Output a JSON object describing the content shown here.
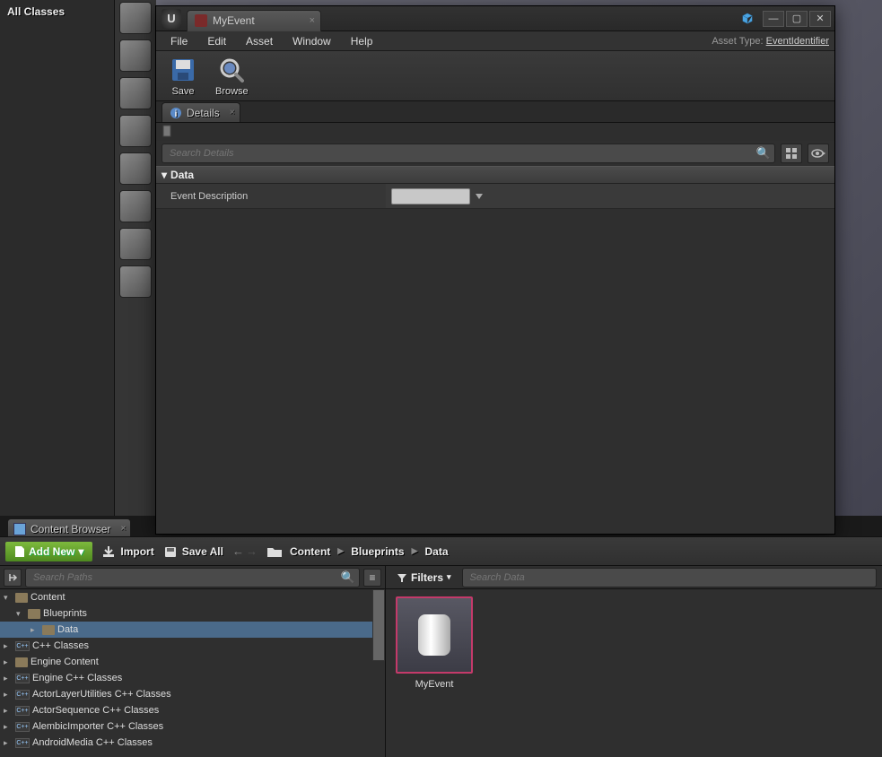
{
  "sidebar": {
    "title": "All Classes"
  },
  "editor": {
    "tab_title": "MyEvent",
    "menu": {
      "file": "File",
      "edit": "Edit",
      "asset": "Asset",
      "window": "Window",
      "help": "Help"
    },
    "asset_type_label": "Asset Type:",
    "asset_type_value": "EventIdentifier",
    "toolbar": {
      "save": "Save",
      "browse": "Browse"
    },
    "details_tab": "Details",
    "search_placeholder": "Search Details",
    "category": "Data",
    "prop_label": "Event Description",
    "prop_value": ""
  },
  "content_browser": {
    "tab": "Content Browser",
    "add_new": "Add New",
    "import": "Import",
    "save_all": "Save All",
    "filters": "Filters",
    "search_paths_placeholder": "Search Paths",
    "search_data_placeholder": "Search Data",
    "breadcrumbs": [
      "Content",
      "Blueprints",
      "Data"
    ],
    "tree": [
      {
        "label": "Content",
        "depth": 0,
        "expanded": true,
        "type": "folder",
        "selected": false
      },
      {
        "label": "Blueprints",
        "depth": 1,
        "expanded": true,
        "type": "folder",
        "selected": false
      },
      {
        "label": "Data",
        "depth": 2,
        "expanded": false,
        "type": "folder",
        "selected": true
      },
      {
        "label": "C++ Classes",
        "depth": 0,
        "expanded": false,
        "type": "cpp",
        "selected": false
      },
      {
        "label": "Engine Content",
        "depth": 0,
        "expanded": false,
        "type": "folder",
        "selected": false
      },
      {
        "label": "Engine C++ Classes",
        "depth": 0,
        "expanded": false,
        "type": "cpp",
        "selected": false
      },
      {
        "label": "ActorLayerUtilities C++ Classes",
        "depth": 0,
        "expanded": false,
        "type": "cpp",
        "selected": false
      },
      {
        "label": "ActorSequence C++ Classes",
        "depth": 0,
        "expanded": false,
        "type": "cpp",
        "selected": false
      },
      {
        "label": "AlembicImporter C++ Classes",
        "depth": 0,
        "expanded": false,
        "type": "cpp",
        "selected": false
      },
      {
        "label": "AndroidMedia C++ Classes",
        "depth": 0,
        "expanded": false,
        "type": "cpp",
        "selected": false
      }
    ],
    "asset": {
      "name": "MyEvent"
    }
  }
}
